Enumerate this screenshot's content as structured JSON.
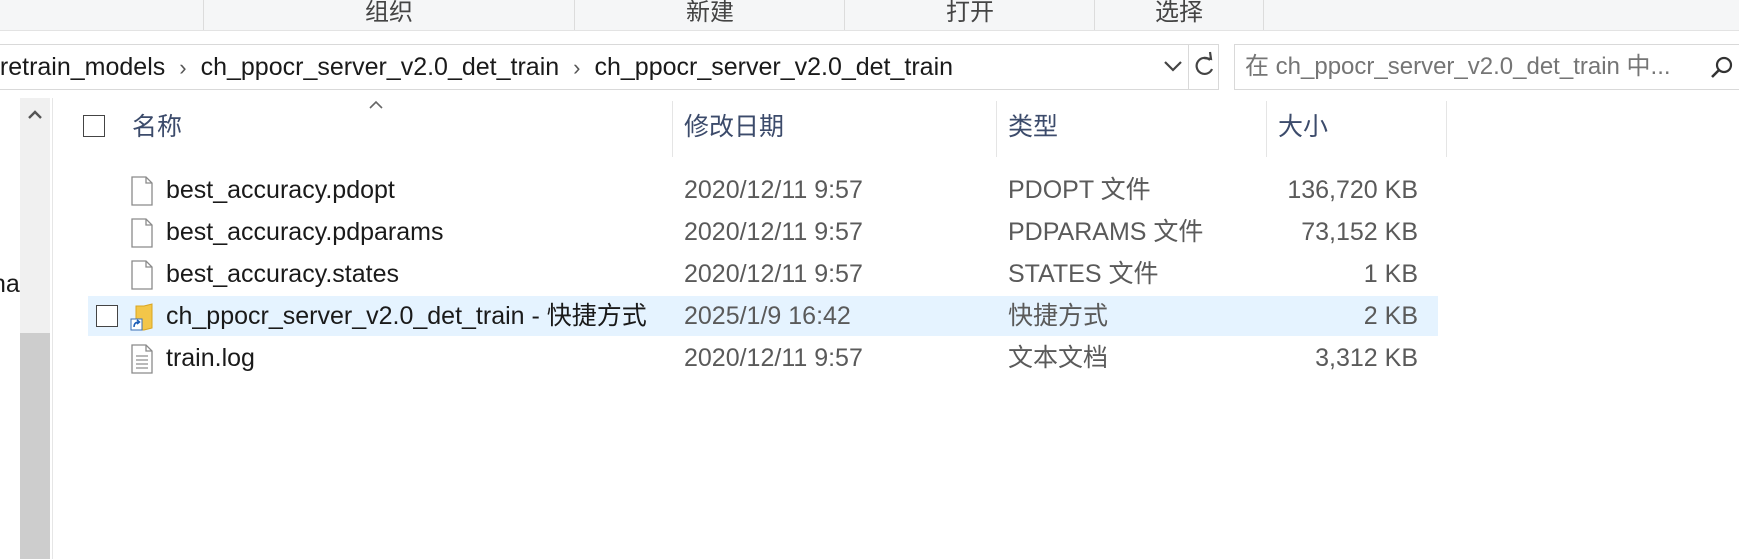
{
  "ribbon": {
    "groups": [
      "组织",
      "新建",
      "打开",
      "选择"
    ]
  },
  "address": {
    "crumbs": [
      "pretrain_models",
      "ch_ppocr_server_v2.0_det_train",
      "ch_ppocr_server_v2.0_det_train"
    ]
  },
  "search": {
    "placeholder": "在 ch_ppocr_server_v2.0_det_train 中..."
  },
  "nav": {
    "partial_label": "na"
  },
  "columns": {
    "name": "名称",
    "date": "修改日期",
    "type": "类型",
    "size": "大小"
  },
  "files": [
    {
      "name": "best_accuracy.pdopt",
      "date": "2020/12/11 9:57",
      "type": "PDOPT 文件",
      "size": "136,720 KB",
      "icon": "file-icon"
    },
    {
      "name": "best_accuracy.pdparams",
      "date": "2020/12/11 9:57",
      "type": "PDPARAMS 文件",
      "size": "73,152 KB",
      "icon": "file-icon"
    },
    {
      "name": "best_accuracy.states",
      "date": "2020/12/11 9:57",
      "type": "STATES 文件",
      "size": "1 KB",
      "icon": "file-icon"
    },
    {
      "name": "ch_ppocr_server_v2.0_det_train - 快捷方式",
      "date": "2025/1/9 16:42",
      "type": "快捷方式",
      "size": "2 KB",
      "icon": "folder-shortcut-icon"
    },
    {
      "name": "train.log",
      "date": "2020/12/11 9:57",
      "type": "文本文档",
      "size": "3,312 KB",
      "icon": "text-file-icon"
    }
  ],
  "colors": {
    "selection": "#e5f3ff",
    "header_text": "#3c4b6b"
  }
}
